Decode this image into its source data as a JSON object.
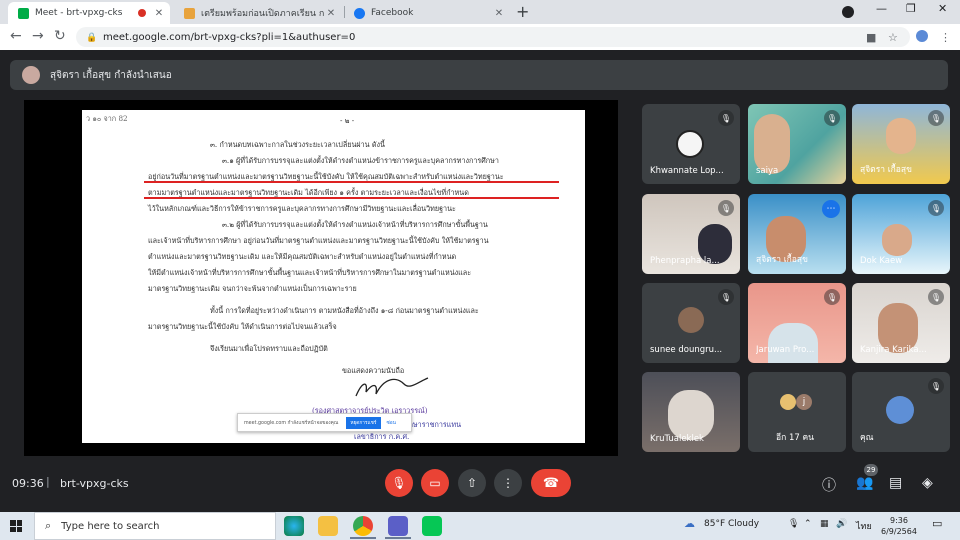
{
  "browser": {
    "tabs": [
      {
        "title": "Meet - brt-vpxg-cks",
        "active": true
      },
      {
        "title": "เตรียมพร้อมก่อนเปิดภาคเรียน การนำเสนอ Powe…",
        "active": false
      },
      {
        "title": "Facebook",
        "active": false
      }
    ],
    "new_tab_label": "+",
    "url": "meet.google.com/brt-vpxg-cks?pli=1&authuser=0"
  },
  "meet": {
    "presenter_text": "สุจิตรา เกื้อสุข กำลังนำเสนอ",
    "document": {
      "lines": [
        "ว ๑๐ จาก 82",
        "- ๒ -",
        "๓. กำหนดบทเฉพาะกาลในช่วงระยะเวลาเปลี่ยนผ่าน ดังนี้",
        "๓.๑ ผู้ที่ได้รับการบรรจุและแต่งตั้งให้ดำรงตำแหน่งข้าราชการครูและบุคลากรทางการศึกษา",
        "อยู่ก่อนวันที่มาตรฐานตำแหน่งและมาตรฐานวิทยฐานะนี้ใช้บังคับ ให้ใช้คุณสมบัติเฉพาะสำหรับตำแหน่งและวิทยฐานะ",
        "ตามมาตรฐานตำแหน่งและมาตรฐานวิทยฐานะเดิม ได้อีกเพียง ๑ ครั้ง ตามระยะเวลาและเงื่อนไขที่กำหนด",
        "ไว้ในหลักเกณฑ์และวิธีการให้ข้าราชการครูและบุคลากรทางการศึกษามีวิทยฐานะและเลื่อนวิทยฐานะ",
        "๓.๒ ผู้ที่ได้รับการบรรจุและแต่งตั้งให้ดำรงตำแหน่งเจ้าหน้าที่บริหารการศึกษาขั้นพื้นฐาน",
        "และเจ้าหน้าที่บริหารการศึกษา อยู่ก่อนวันที่มาตรฐานตำแหน่งและมาตรฐานวิทยฐานะนี้ใช้บังคับ ให้ใช้มาตรฐาน",
        "ตำแหน่งและมาตรฐานวิทยฐานะเดิม และให้มีคุณสมบัติเฉพาะสำหรับตำแหน่งอยู่ในตำแหน่งที่กำหนด",
        "ให้มีตำแหน่งเจ้าหน้าที่บริหารการศึกษาขั้นพื้นฐานและเจ้าหน้าที่บริหารการศึกษาในมาตรฐานตำแหน่งและ",
        "มาตรฐานวิทยฐานะเดิม จนกว่าจะพ้นจากตำแหน่งเป็นการเฉพาะราย",
        "ทั้งนี้ การใดที่อยู่ระหว่างดำเนินการ ตามหนังสือที่อ้างถึง ๑-๘ ก่อนมาตรฐานตำแหน่งและ",
        "มาตรฐานวิทยฐานะนี้ใช้บังคับ ให้ดำเนินการต่อไปจนแล้วเสร็จ",
        "จึงเรียนมาเพื่อโปรดทราบและถือปฏิบัติ",
        "ขอแสดงความนับถือ",
        "(รองศาสตราจารย์ประวิต เอราวรรณ์)",
        "ภาค 2 รักษาราชการแทน",
        "เลขาธิการ ก.ค.ศ."
      ],
      "share_popup": {
        "text": "meet.google.com กำลังแชร์หน้าจอของคุณ",
        "stop": "หยุดการแชร์",
        "hide": "ซ่อน"
      }
    },
    "participants": [
      {
        "name": "Khwannate Lop...",
        "muted": true
      },
      {
        "name": "saiya",
        "muted": true
      },
      {
        "name": "สุจิตรา เกื้อสุข",
        "muted": true
      },
      {
        "name": "Phenprapha la...",
        "muted": true
      },
      {
        "name": "สุจิตรา เกื้อสุข",
        "muted": false,
        "more": "⋯"
      },
      {
        "name": "Dok Kaew",
        "muted": true
      },
      {
        "name": "sunee doungru...",
        "muted": true
      },
      {
        "name": "Jaruwan Pro...",
        "muted": true
      },
      {
        "name": "Kanjira Karika...",
        "muted": true
      },
      {
        "name": "KruTualeklek",
        "muted": true
      },
      {
        "name": "อีก 17 คน",
        "muted": false,
        "avatar_letter": "j"
      },
      {
        "name": "คุณ",
        "muted": true
      }
    ],
    "time": "09:36",
    "meeting_code": "brt-vpxg-cks",
    "people_count": "29"
  },
  "taskbar": {
    "search_placeholder": "Type here to search",
    "weather": "85°F  Cloudy",
    "language": "ไทย",
    "time": "9:36",
    "date": "6/9/2564"
  }
}
